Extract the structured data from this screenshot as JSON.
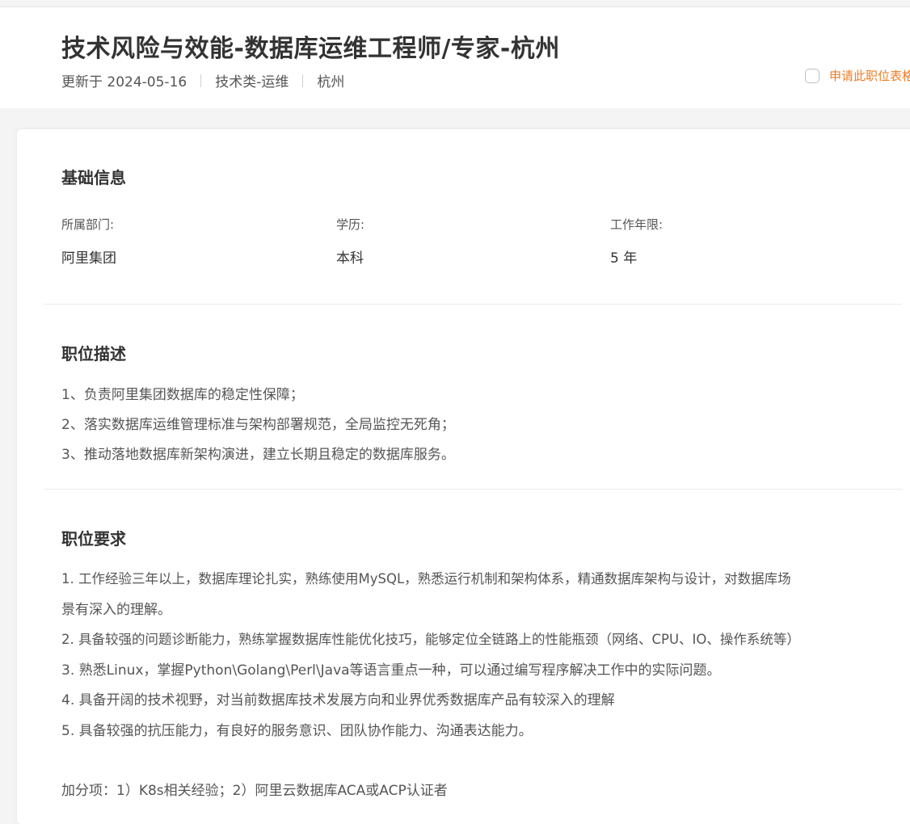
{
  "header": {
    "title": "技术风险与效能-数据库运维工程师/专家-杭州",
    "updated": "更新于 2024-05-16",
    "category": "技术类-运维",
    "city": "杭州",
    "apply_label": "申请此职位表格"
  },
  "basic_info": {
    "title": "基础信息",
    "department_label": "所属部门:",
    "department_value": "阿里集团",
    "education_label": "学历:",
    "education_value": "本科",
    "experience_label": "工作年限:",
    "experience_value": "5 年"
  },
  "description": {
    "title": "职位描述",
    "lines": [
      "1、负责阿里集团数据库的稳定性保障；",
      "2、落实数据库运维管理标准与架构部署规范，全局监控无死角；",
      "3、推动落地数据库新架构演进，建立长期且稳定的数据库服务。"
    ]
  },
  "requirements": {
    "title": "职位要求",
    "lines": [
      "1. 工作经验三年以上，数据库理论扎实，熟练使用MySQL，熟悉运行机制和架构体系，精通数据库架构与设计，对数据库场",
      "景有深入的理解。",
      "2. 具备较强的问题诊断能力，熟练掌握数据库性能优化技巧，能够定位全链路上的性能瓶颈（网络、CPU、IO、操作系统等）",
      "3. 熟悉Linux，掌握Python\\Golang\\Perl\\Java等语言重点一种，可以通过编写程序解决工作中的实际问题。",
      "4. 具备开阔的技术视野，对当前数据库技术发展方向和业界优秀数据库产品有较深入的理解",
      "5. 具备较强的抗压能力，有良好的服务意识、团队协作能力、沟通表达能力。"
    ],
    "bonus": "加分项：1）K8s相关经验；2）阿里云数据库ACA或ACP认证者"
  }
}
